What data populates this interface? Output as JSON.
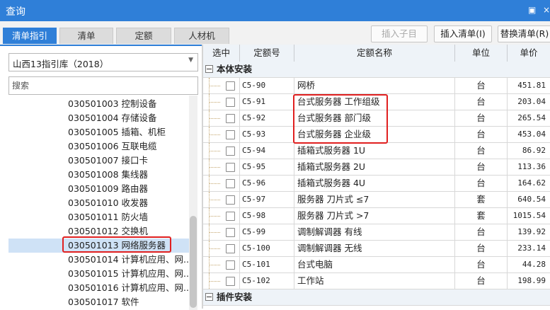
{
  "window": {
    "title": "查询",
    "restore_glyph": "▣",
    "close_glyph": "×"
  },
  "tabs": [
    {
      "label": "清单指引",
      "active": true
    },
    {
      "label": "清单",
      "active": false
    },
    {
      "label": "定额",
      "active": false
    },
    {
      "label": "人材机",
      "active": false
    }
  ],
  "toolbar": {
    "insert_child_label": "插入子目",
    "insert_bill_label": "插入清单(I)",
    "replace_bill_label": "替换清单(R)"
  },
  "library_select": {
    "value": "山西13指引库（2018）"
  },
  "search": {
    "placeholder": "搜索"
  },
  "tree": {
    "items": [
      {
        "text": "030501003  控制设备",
        "selected": false
      },
      {
        "text": "030501004  存储设备",
        "selected": false
      },
      {
        "text": "030501005  插箱、机柜",
        "selected": false
      },
      {
        "text": "030501006  互联电缆",
        "selected": false
      },
      {
        "text": "030501007  接口卡",
        "selected": false
      },
      {
        "text": "030501008  集线器",
        "selected": false
      },
      {
        "text": "030501009  路由器",
        "selected": false
      },
      {
        "text": "030501010  收发器",
        "selected": false
      },
      {
        "text": "030501011  防火墙",
        "selected": false
      },
      {
        "text": "030501012  交换机",
        "selected": false
      },
      {
        "text": "030501013  网络服务器",
        "selected": true
      },
      {
        "text": "030501014  计算机应用、网...",
        "selected": false
      },
      {
        "text": "030501015  计算机应用、网...",
        "selected": false
      },
      {
        "text": "030501016  计算机应用、网...",
        "selected": false
      },
      {
        "text": "030501017  软件",
        "selected": false
      }
    ]
  },
  "grid": {
    "columns": [
      "选中",
      "定额号",
      "定额名称",
      "单位",
      "单价"
    ],
    "groups": [
      {
        "label": "本体安装",
        "rows": [
          {
            "code": "C5-90",
            "name": "网桥",
            "unit": "台",
            "price": "451.81"
          },
          {
            "code": "C5-91",
            "name": "台式服务器 工作组级",
            "unit": "台",
            "price": "203.04"
          },
          {
            "code": "C5-92",
            "name": "台式服务器 部门级",
            "unit": "台",
            "price": "265.54"
          },
          {
            "code": "C5-93",
            "name": "台式服务器 企业级",
            "unit": "台",
            "price": "453.04"
          },
          {
            "code": "C5-94",
            "name": "插箱式服务器 1U",
            "unit": "台",
            "price": "86.92"
          },
          {
            "code": "C5-95",
            "name": "插箱式服务器 2U",
            "unit": "台",
            "price": "113.36"
          },
          {
            "code": "C5-96",
            "name": "插箱式服务器 4U",
            "unit": "台",
            "price": "164.62"
          },
          {
            "code": "C5-97",
            "name": "服务器 刀片式 ≤7",
            "unit": "套",
            "price": "640.54"
          },
          {
            "code": "C5-98",
            "name": "服务器 刀片式 >7",
            "unit": "套",
            "price": "1015.54"
          },
          {
            "code": "C5-99",
            "name": "调制解调器 有线",
            "unit": "台",
            "price": "139.92"
          },
          {
            "code": "C5-100",
            "name": "调制解调器 无线",
            "unit": "台",
            "price": "233.14"
          },
          {
            "code": "C5-101",
            "name": "台式电脑",
            "unit": "台",
            "price": "44.28"
          },
          {
            "code": "C5-102",
            "name": "工作站",
            "unit": "台",
            "price": "198.99"
          }
        ]
      },
      {
        "label": "插件安装",
        "rows": []
      }
    ]
  },
  "colors": {
    "accent": "#2f7fd8",
    "highlight_border": "#e02020",
    "selected_row": "#cfe2f6"
  }
}
